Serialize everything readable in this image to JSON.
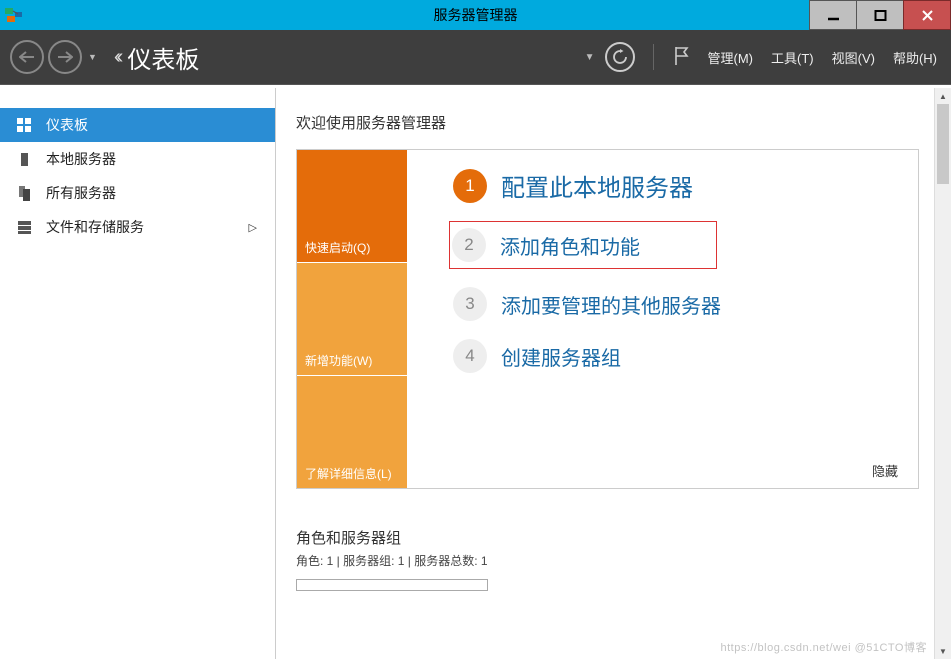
{
  "titlebar": {
    "title": "服务器管理器"
  },
  "cmdbar": {
    "breadcrumb": "仪表板",
    "menus": {
      "manage": "管理(M)",
      "tools": "工具(T)",
      "view": "视图(V)",
      "help": "帮助(H)"
    }
  },
  "sidebar": {
    "items": [
      {
        "label": "仪表板",
        "selected": true
      },
      {
        "label": "本地服务器",
        "selected": false
      },
      {
        "label": "所有服务器",
        "selected": false
      },
      {
        "label": "文件和存储服务",
        "selected": false,
        "expandable": true
      }
    ]
  },
  "content": {
    "welcome_title": "欢迎使用服务器管理器",
    "tiles": {
      "quickstart": "快速启动(Q)",
      "whatsnew": "新增功能(W)",
      "learnmore": "了解详细信息(L)"
    },
    "steps": [
      {
        "num": "1",
        "text": "配置此本地服务器",
        "primary": true,
        "highlight": false
      },
      {
        "num": "2",
        "text": "添加角色和功能",
        "primary": false,
        "highlight": true
      },
      {
        "num": "3",
        "text": "添加要管理的其他服务器",
        "primary": false,
        "highlight": false
      },
      {
        "num": "4",
        "text": "创建服务器组",
        "primary": false,
        "highlight": false
      }
    ],
    "hide_link": "隐藏",
    "groups_title": "角色和服务器组",
    "groups_sub": "角色: 1 | 服务器组: 1 | 服务器总数: 1"
  },
  "watermark": "https://blog.csdn.net/wei @51CTO博客"
}
